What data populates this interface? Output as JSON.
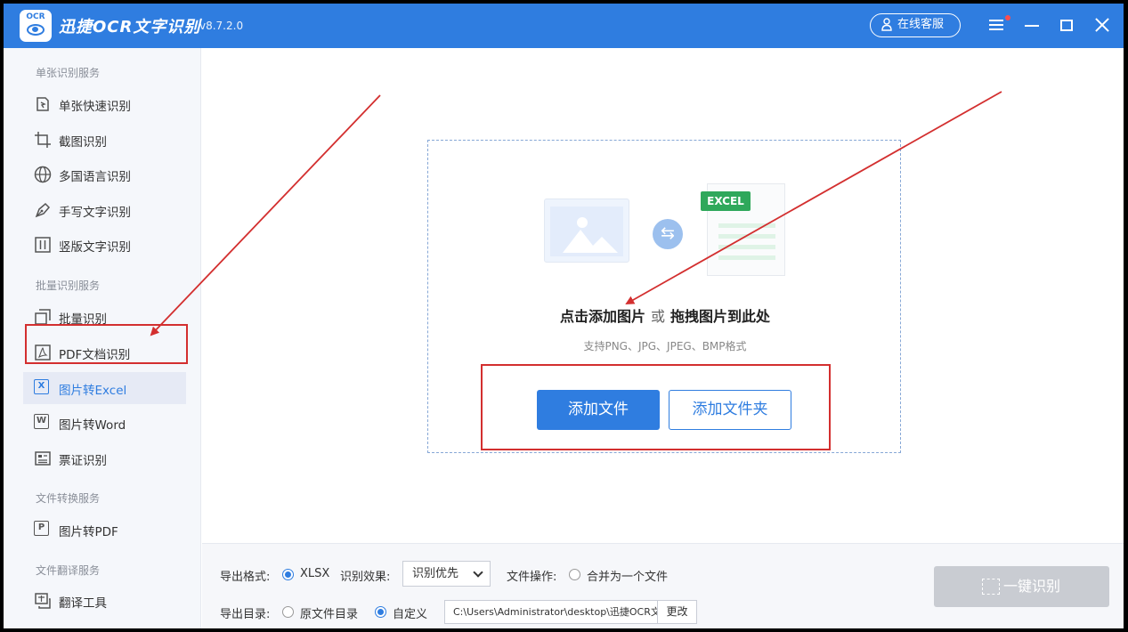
{
  "titlebar": {
    "logo_text": "OCR",
    "title": "迅捷OCR文字识别",
    "version": "v8.7.2.0",
    "service_label": "在线客服"
  },
  "sidebar": {
    "sections": [
      {
        "title": "单张识别服务",
        "items": [
          {
            "label": "单张快速识别",
            "icon": "quick-scan-icon"
          },
          {
            "label": "截图识别",
            "icon": "crop-icon"
          },
          {
            "label": "多国语言识别",
            "icon": "globe-icon"
          },
          {
            "label": "手写文字识别",
            "icon": "pen-icon"
          },
          {
            "label": "竖版文字识别",
            "icon": "vertical-text-icon"
          }
        ]
      },
      {
        "title": "批量识别服务",
        "items": [
          {
            "label": "批量识别",
            "icon": "batch-icon"
          },
          {
            "label": "PDF文档识别",
            "icon": "pdf-icon"
          },
          {
            "label": "图片转Excel",
            "icon": "excel-icon",
            "glyph": "X",
            "active": true
          },
          {
            "label": "图片转Word",
            "icon": "word-icon",
            "glyph": "W"
          },
          {
            "label": "票证识别",
            "icon": "ticket-icon"
          }
        ]
      },
      {
        "title": "文件转换服务",
        "items": [
          {
            "label": "图片转PDF",
            "icon": "pdf-convert-icon",
            "glyph": "P"
          }
        ]
      },
      {
        "title": "文件翻译服务",
        "items": [
          {
            "label": "翻译工具",
            "icon": "translate-icon"
          }
        ]
      }
    ]
  },
  "main": {
    "excel_tag": "EXCEL",
    "hint_click": "点击添加图片",
    "hint_or": "或",
    "hint_drag": "拖拽图片到此处",
    "formats": "支持PNG、JPG、JPEG、BMP格式",
    "add_file": "添加文件",
    "add_folder": "添加文件夹"
  },
  "bottom": {
    "export_format_label": "导出格式:",
    "export_format_value": "XLSX",
    "effect_label": "识别效果:",
    "effect_value": "识别优先",
    "file_op_label": "文件操作:",
    "merge_label": "合并为一个文件",
    "export_dir_label": "导出目录:",
    "origin_dir_label": "原文件目录",
    "custom_label": "自定义",
    "path_value": "C:\\Users\\Administrator\\desktop\\迅捷OCR文",
    "change_label": "更改",
    "recognize_label": "一键识别"
  },
  "colors": {
    "accent": "#2f7de0",
    "highlight": "#d32f2f",
    "excel_green": "#2fa85b"
  }
}
